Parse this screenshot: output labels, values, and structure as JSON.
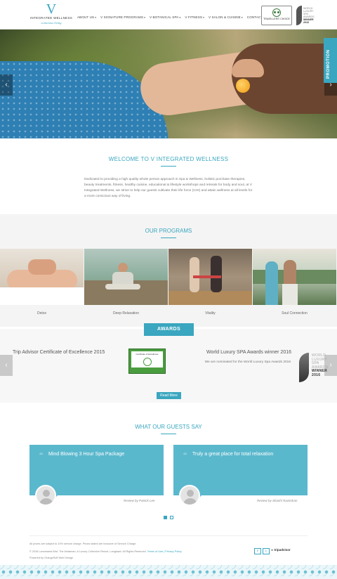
{
  "header": {
    "logo_letter": "V",
    "logo_name": "INTEGRATED WELLNESS",
    "logo_tagline": "conscious living",
    "nav": [
      "ABOUT US",
      "V SIGNATURE PROGRAMS",
      "V BOTANICAL SPA",
      "V FITNESS",
      "V SALON & CUISINE",
      "CONTACT US"
    ],
    "tripadvisor_badge": "TRAVELLERS' CHOICE",
    "award_lines": [
      "WORLD",
      "LUXURY",
      "SPA",
      "AWARDS"
    ],
    "award_winner": "WINNER",
    "award_year": "2016"
  },
  "hero": {
    "promotion_label": "PROMOTION",
    "prev_label": "‹",
    "next_label": "›"
  },
  "welcome": {
    "title": "WELCOME TO V INTEGRATED WELLNESS",
    "text": "Dedicated to providing a high quality whole person approach in Spa & Wellness, holistic purchase therapies, beauty treatments, fitness, healthy cuisine, educational & lifestyle workshops and retreats for body and soul, at V Integrated Wellness, we strive to help our guests cultivate their life force (CHI) and attain wellness at all levels for a more conscious way of living."
  },
  "programs": {
    "title": "OUR PROGRAMS",
    "items": [
      "Detox",
      "Deep Relaxation",
      "Vitality",
      "Soul Connection"
    ]
  },
  "awards": {
    "tab_label": "AWARDS",
    "left_title": "Trip Advisor Certificate of Excellence 2015",
    "cert_title": "Certificate of Excellence",
    "right_title": "World Luxury SPA Awards winner 2016",
    "right_text": "We are nominated for the World Luxury Spa Awards 2016",
    "read_more": "Read More",
    "prev_label": "‹",
    "next_label": "›"
  },
  "guests": {
    "title": "WHAT OUR GUESTS SAY",
    "reviews": [
      {
        "title": "Mind Blowing 3 Hour Spa Package",
        "by": "Review by Patrick Lee"
      },
      {
        "title": "Truly a great place for total relaxation",
        "by": "Review by Shashi Ravindran"
      }
    ]
  },
  "footer": {
    "line1": "All prices are subject to 10% service charge. Prices stated are inclusive of Service Charge.",
    "line2": "© 2016 Lanomania Bhd. The Andaman, A Luxury Collection Resort, Langkawi. All Rights Reserved.",
    "links": "Terms of Use | Privacy Policy",
    "line3": "Powered by OrangeSoft Web Design",
    "facebook": "f",
    "twitter": "t",
    "tripadvisor": "tripadvisor"
  },
  "colors": {
    "accent": "#3aa6bf",
    "card": "#5ab8cd"
  }
}
